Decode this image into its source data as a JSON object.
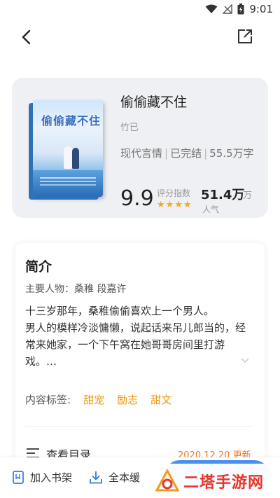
{
  "status_bar": {
    "time": "9:01"
  },
  "book": {
    "title": "偷偷藏不住",
    "author": "竹已",
    "genre": "现代言情",
    "status": "已完结",
    "word_count": "55.5万字",
    "score": "9.9",
    "score_label": "评分指数",
    "rating_stars": 4,
    "popularity": "51.4万",
    "popularity_unit": "万",
    "popularity_value": "51.4",
    "popularity_label": "人气",
    "cover_title": "偷偷藏不住"
  },
  "intro": {
    "heading": "简介",
    "main_characters": "主要人物：桑稚 段嘉许",
    "synopsis_line1": "十三岁那年，桑稚偷偷喜欢上一个男人。",
    "synopsis_line2": "男人的模样冷淡慵懒，说起话来吊儿郎当的，经常来她家，一个下午窝在她哥哥房间里打游戏。…",
    "tags_label": "内容标签:",
    "tags": [
      "甜宠",
      "励志",
      "甜文"
    ]
  },
  "toc": {
    "label": "查看目录",
    "update": "2020.12.20 更新"
  },
  "bottom_bar": {
    "add_shelf": "加入书架",
    "download": "全本缓"
  },
  "watermark": {
    "text": "二塔手游网"
  },
  "colors": {
    "accent": "#f0950c",
    "card_bg": "#eef0f3",
    "star": "#f5a623",
    "watermark": "#e8362a"
  }
}
